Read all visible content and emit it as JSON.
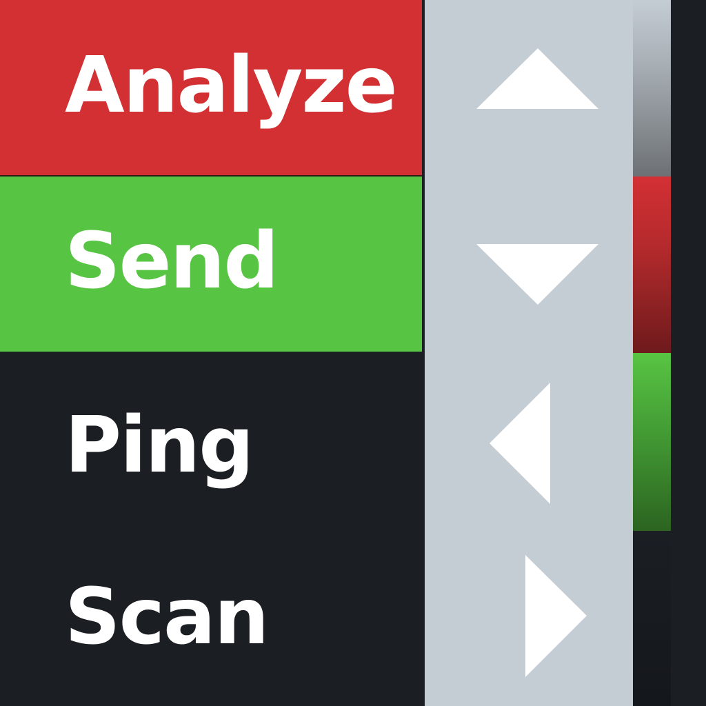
{
  "menu": {
    "items": [
      {
        "label": "Analyze",
        "color": "#d33034",
        "selected": false
      },
      {
        "label": "Send",
        "color": "#58c443",
        "selected": true
      },
      {
        "label": "Ping",
        "color": "#1b1f24",
        "selected": false
      },
      {
        "label": "Scan",
        "color": "#1b1f24",
        "selected": false
      }
    ]
  },
  "controls": {
    "background": "#c4ccd4",
    "buttons": [
      {
        "icon": "arrow-up-icon"
      },
      {
        "icon": "arrow-down-icon"
      },
      {
        "icon": "arrow-left-icon"
      },
      {
        "icon": "arrow-right-icon"
      }
    ]
  },
  "swatches": [
    {
      "color": "#c4ccd4"
    },
    {
      "color": "#d33034"
    },
    {
      "color": "#58c443"
    },
    {
      "color": "#1b1f24"
    }
  ]
}
